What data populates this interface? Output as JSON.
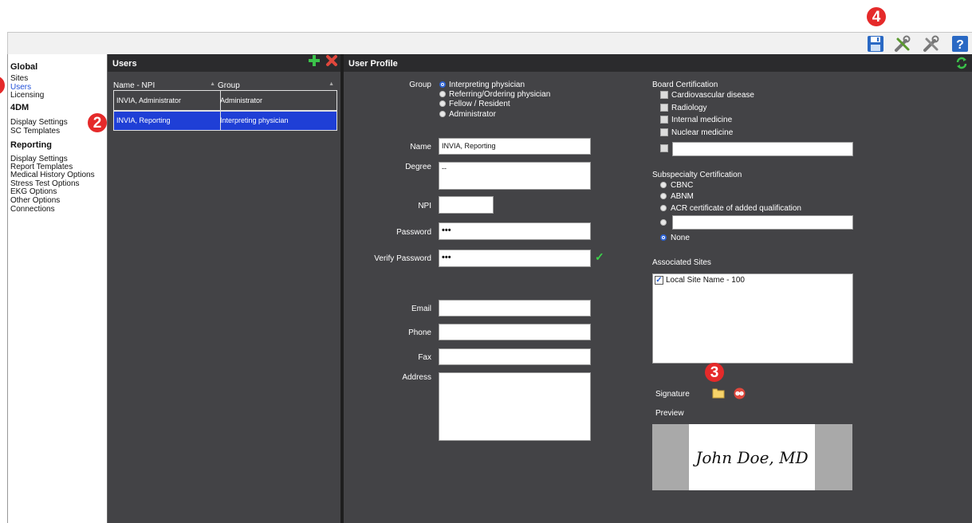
{
  "markers": {
    "m2": "2",
    "m3": "3",
    "m4": "4"
  },
  "toolbar": {
    "icons": [
      "save-icon",
      "tools-icon",
      "wrench-screwdriver-icon",
      "help-icon"
    ]
  },
  "sidebar": {
    "global_title": "Global",
    "global_items": [
      "Sites",
      "Users",
      "Licensing"
    ],
    "fourdm_title": "4DM",
    "fourdm_items": [
      "Display Settings",
      "SC Templates"
    ],
    "reporting_title": "Reporting",
    "reporting_items": [
      "Display Settings",
      "Report Templates",
      "Medical History Options",
      "Stress Test Options",
      "EKG Options",
      "Other Options",
      "Connections"
    ]
  },
  "users": {
    "title": "Users",
    "col_name": "Name - NPI",
    "col_group": "Group",
    "rows": [
      {
        "name": "INVIA, Administrator",
        "group": "Administrator"
      },
      {
        "name": "INVIA, Reporting",
        "group": "Interpreting physician"
      }
    ]
  },
  "profile": {
    "title": "User Profile",
    "group_label": "Group",
    "group_options": [
      "Interpreting physician",
      "Referring/Ordering physician",
      "Fellow / Resident",
      "Administrator"
    ],
    "group_selected": "Interpreting physician",
    "name_label": "Name",
    "name_value": "INVIA, Reporting",
    "degree_label": "Degree",
    "degree_value": "--",
    "npi_label": "NPI",
    "npi_value": "",
    "password_label": "Password",
    "password_value": "•••",
    "verify_label": "Verify Password",
    "verify_value": "•••",
    "verify_check": "✓",
    "email_label": "Email",
    "phone_label": "Phone",
    "fax_label": "Fax",
    "address_label": "Address",
    "board_title": "Board Certification",
    "board_options": [
      "Cardiovascular disease",
      "Radiology",
      "Internal medicine",
      "Nuclear medicine"
    ],
    "subspecialty_title": "Subspecialty Certification",
    "subspecialty_options": [
      "CBNC",
      "ABNM",
      "ACR certificate of added qualification"
    ],
    "subspecialty_none": "None",
    "sites_title": "Associated Sites",
    "sites": [
      {
        "label": "Local Site Name - 100",
        "checked": true
      }
    ],
    "signature_label": "Signature",
    "preview_label": "Preview",
    "signature_text": "John Doe, MD"
  },
  "colors": {
    "accent": "#1f4fd8",
    "selected_row": "#1f3fd6",
    "panel": "#434346",
    "header": "#2b2b2d",
    "marker": "#e52a2a"
  }
}
